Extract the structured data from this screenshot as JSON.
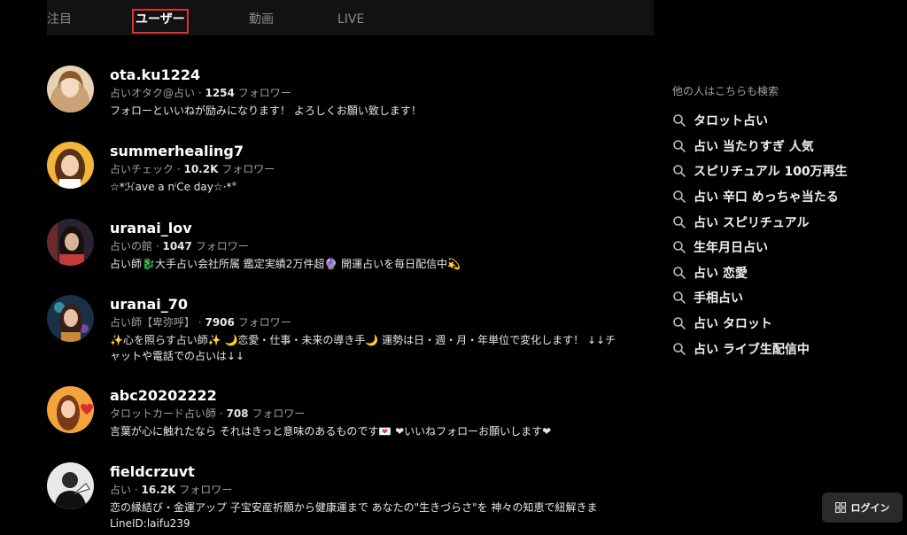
{
  "tabs": [
    {
      "label": "注目"
    },
    {
      "label": "ユーザー",
      "active": true
    },
    {
      "label": "動画"
    },
    {
      "label": "LIVE"
    }
  ],
  "users": [
    {
      "name": "ota.ku1224",
      "subtitle": "占いオタク@占い",
      "followers": "1254",
      "followers_label": "フォロワー",
      "bio": "フォローといいねが励みになります！ よろしくお願い致します！"
    },
    {
      "name": "summerhealing7",
      "subtitle": "占いチェック",
      "followers": "10.2K",
      "followers_label": "フォロワー",
      "bio": "☆*ℋave a nⁱCe day☆·*°"
    },
    {
      "name": "uranai_lov",
      "subtitle": "占いの館",
      "followers": "1047",
      "followers_label": "フォロワー",
      "bio": "占い師🐉大手占い会社所属 鑑定実績2万件超🔮 開運占いを毎日配信中💫"
    },
    {
      "name": "uranai_70",
      "subtitle": "占い師【卑弥呼】",
      "followers": "7906",
      "followers_label": "フォロワー",
      "bio": "✨心を照らす占い師✨ 🌙恋愛・仕事・未来の導き手🌙 運勢は日・週・月・年単位で変化します！ ↓↓チャットや電話での占いは↓↓"
    },
    {
      "name": "abc20202222",
      "subtitle": "タロットカード占い師",
      "followers": "708",
      "followers_label": "フォロワー",
      "bio": "言葉が心に触れたなら それはきっと意味のあるものです💌 ❤いいねフォローお願いします❤"
    },
    {
      "name": "fieldcrzuvt",
      "subtitle": "占い",
      "followers": "16.2K",
      "followers_label": "フォロワー",
      "bio": "恋の縁結び・金運アップ 子宝安産祈願から健康運まで あなたの\"生きづらさ\"を 神々の知恵で紐解きま LineID:laifu239"
    }
  ],
  "sidebar": {
    "title": "他の人はこちらも検索",
    "icon": "search-icon",
    "suggestions": [
      "タロット占い",
      "占い 当たりすぎ 人気",
      "スピリチュアル 100万再生",
      "占い 辛口 めっちゃ当たる",
      "占い スピリチュアル",
      "生年月日占い",
      "占い 恋愛",
      "手相占い",
      "占い タロット",
      "占い ライブ生配信中"
    ]
  },
  "login": {
    "label": "ログイン",
    "icon": "grid-icon"
  },
  "colors": {
    "background": "#000000",
    "tab_highlight": "#e03030",
    "muted": "#a0a0a0"
  }
}
